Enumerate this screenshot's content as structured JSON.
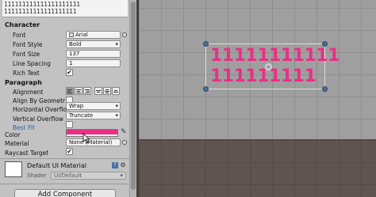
{
  "text_area": {
    "line1": "111111111111111111111",
    "line2": "11111111111111111111"
  },
  "sections": {
    "character": "Character",
    "paragraph": "Paragraph"
  },
  "character": {
    "font_label": "Font",
    "font_value": "Arial",
    "font_style_label": "Font Style",
    "font_style_value": "Bold",
    "font_size_label": "Font Size",
    "font_size_value": "137",
    "line_spacing_label": "Line Spacing",
    "line_spacing_value": "1",
    "rich_text_label": "Rich Text",
    "rich_text_checked": true
  },
  "paragraph": {
    "alignment_label": "Alignment",
    "align_geometry_label": "Align By Geometr",
    "h_overflow_label": "Horizontal Overflo",
    "h_overflow_value": "Wrap",
    "v_overflow_label": "Vertical Overflow",
    "v_overflow_value": "Truncate",
    "best_fit_label": "Best Fit",
    "best_fit_checked": false
  },
  "color": {
    "label": "Color",
    "value": "#EA2F85"
  },
  "material": {
    "label": "Material",
    "value": "None (Material)"
  },
  "raycast": {
    "label": "Raycast Target",
    "checked": true
  },
  "material_preview": {
    "title": "Default UI Material",
    "shader_label": "Shader",
    "shader_value": "UI/Default"
  },
  "add_component": {
    "label": "Add Component"
  },
  "scene": {
    "text_line1": "11111111111",
    "text_line2": "111111111",
    "text_color": "#EA2F85"
  },
  "icons": {
    "font": "font-asset-icon",
    "target": "object-picker-icon",
    "eyedropper": "eyedropper-icon",
    "book": "help-book-icon",
    "gear": "gear-icon"
  }
}
